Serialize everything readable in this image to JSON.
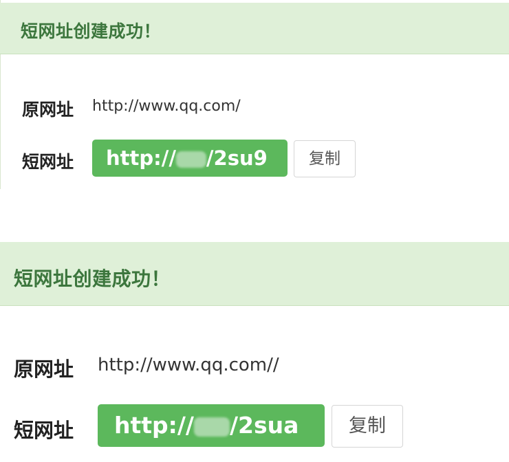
{
  "panels": [
    {
      "title": "短网址创建成功！",
      "original_label": "原网址",
      "original_url": "http://www.qq.com/",
      "short_label": "短网址",
      "short_prefix": "http://",
      "short_suffix": "/2su9",
      "copy_label": "复制"
    },
    {
      "title": "短网址创建成功！",
      "original_label": "原网址",
      "original_url": "http://www.qq.com//",
      "short_label": "短网址",
      "short_prefix": "http://",
      "short_suffix": "/2sua",
      "copy_label": "复制"
    }
  ],
  "colors": {
    "header_bg": "#dff0d8",
    "header_text": "#3c763d",
    "short_url_bg": "#5cb85c"
  }
}
